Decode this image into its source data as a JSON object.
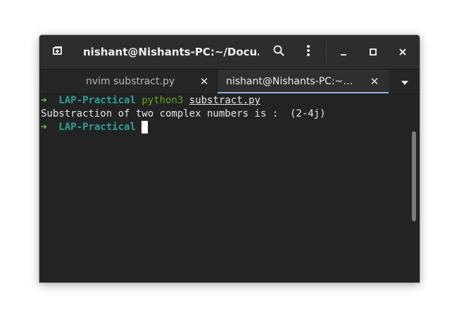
{
  "window": {
    "title": "nishant@Nishants-PC:~/Docu…",
    "icons": {
      "new_tab": "new-tab-icon",
      "search": "search-icon",
      "menu": "kebab-menu-icon",
      "minimize": "minimize-icon",
      "maximize": "maximize-icon",
      "close": "close-icon"
    }
  },
  "tabs": [
    {
      "label": "nvim substract.py",
      "active": false,
      "close_glyph": "✕"
    },
    {
      "label": "nishant@Nishants-PC:~…",
      "active": true,
      "close_glyph": "✕"
    }
  ],
  "tab_menu_icon": "chevron-down-icon",
  "terminal": {
    "prompt_arrow": "➜",
    "lines": [
      {
        "dir": "LAP-Practical",
        "command": "python3",
        "argument": "substract.py"
      },
      {
        "output": "Substraction of two complex numbers is :  (2-4j)"
      },
      {
        "dir": "LAP-Practical"
      }
    ]
  },
  "colors": {
    "prompt_arrow": "#7ecb3f",
    "prompt_dir": "#2aa198",
    "command": "#64a31a",
    "active_tab_underline": "#8fb6e6",
    "background": "#232323"
  }
}
